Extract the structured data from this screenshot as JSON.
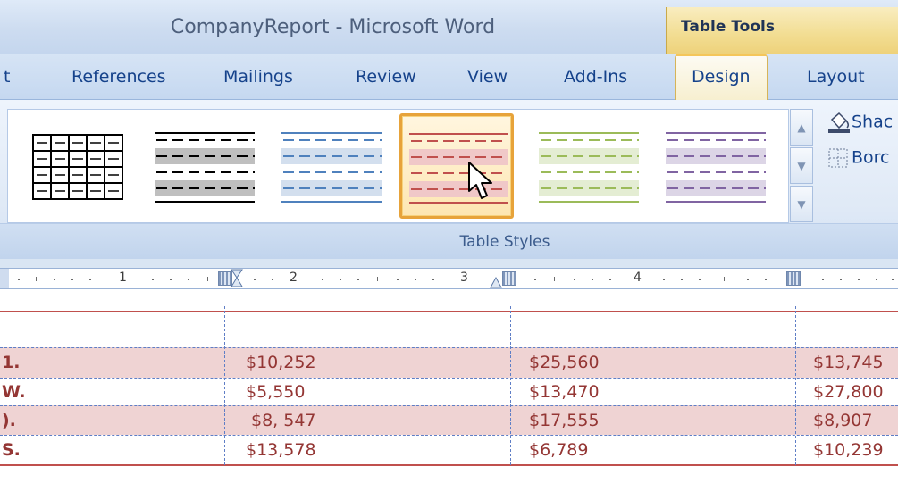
{
  "window": {
    "title": "CompanyReport - Microsoft Word",
    "contextual_group": "Table Tools"
  },
  "tabs": [
    {
      "label": "t"
    },
    {
      "label": "References"
    },
    {
      "label": "Mailings"
    },
    {
      "label": "Review"
    },
    {
      "label": "View"
    },
    {
      "label": "Add-Ins"
    },
    {
      "label": "Design",
      "active": true
    },
    {
      "label": "Layout"
    }
  ],
  "ribbon": {
    "group_label": "Table Styles",
    "gallery": {
      "styles": [
        {
          "name": "table-grid",
          "color": "#000000"
        },
        {
          "name": "light-shading",
          "color": "#808080"
        },
        {
          "name": "light-shading-accent-1",
          "color": "#4f81bd"
        },
        {
          "name": "light-shading-accent-2",
          "color": "#c0504d",
          "selected": true
        },
        {
          "name": "light-shading-accent-3",
          "color": "#9bbb59"
        },
        {
          "name": "light-shading-accent-4",
          "color": "#8064a2"
        }
      ]
    },
    "commands": {
      "shading": "Shac",
      "borders": "Borc"
    }
  },
  "ruler": {
    "numbers": [
      "1",
      "2",
      "3",
      "4"
    ]
  },
  "table": {
    "rows": [
      {
        "name": "",
        "values": [
          "",
          "",
          ""
        ]
      },
      {
        "name": "1.",
        "values": [
          "$10,252",
          "$25,560",
          "$13,745"
        ]
      },
      {
        "name": "W.",
        "values": [
          "$5,550",
          "$13,470",
          "$27,800"
        ]
      },
      {
        "name": ").",
        "values": [
          "$8, 547",
          "$17,555",
          "$8,907"
        ]
      },
      {
        "name": "S.",
        "values": [
          "$13,578",
          "$6,789",
          "$10,239"
        ]
      }
    ]
  },
  "colors": {
    "accent_text": "#943634",
    "row_shading": "#efd3d3",
    "border": "#c0504d",
    "selection": "#e7a33a"
  }
}
